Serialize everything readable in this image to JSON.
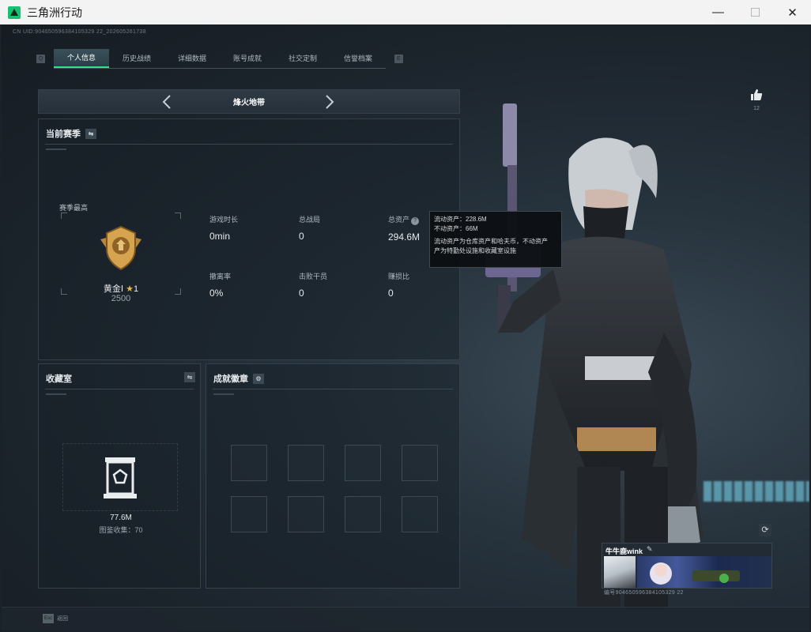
{
  "window": {
    "title": "三角洲行动",
    "controls": {
      "minimize": "—",
      "maximize": "☐",
      "close": "✕"
    }
  },
  "header": {
    "uid_text": "CN UID:904650596384105329 22_202605261738",
    "tab_key_left": "Q",
    "tab_key_right": "E",
    "tabs": [
      "个人信息",
      "历史战绩",
      "详细数据",
      "账号成就",
      "社交定制",
      "信誉档案"
    ],
    "active_tab": 0
  },
  "mode": {
    "label": "烽火地带"
  },
  "season": {
    "title": "当前赛季",
    "best_label": "赛季最高",
    "rank_name": "黄金Ⅰ",
    "rank_stars": "1",
    "rank_score": "2500",
    "stats": [
      {
        "label": "游戏时长",
        "value": "0min"
      },
      {
        "label": "总战局",
        "value": "0"
      },
      {
        "label": "总资产",
        "value": "294.6M"
      },
      {
        "label": "撤离率",
        "value": "0%"
      },
      {
        "label": "击败干员",
        "value": "0"
      },
      {
        "label": "赚损比",
        "value": "0"
      }
    ]
  },
  "tooltip": {
    "line1": "流动资产：228.6M",
    "line2": "不动资产：66M",
    "line3": "流动资产为仓库资产和哈夫币，不动资产",
    "line4": "产为特勤处设施和收藏室设施"
  },
  "collection": {
    "title": "收藏室",
    "value": "77.6M",
    "count": "图鉴收集：70"
  },
  "badges": {
    "title": "成就徽章"
  },
  "like": {
    "count": "12"
  },
  "player": {
    "name": "牛牛鹿wink",
    "uid": "编号904650596384105329 22"
  },
  "footer": {
    "esc_key": "Esc",
    "esc_label": "返回"
  },
  "colors": {
    "accent": "#2fe08a",
    "gold": "#c8953f",
    "window_bg": "#f3f3f3"
  }
}
